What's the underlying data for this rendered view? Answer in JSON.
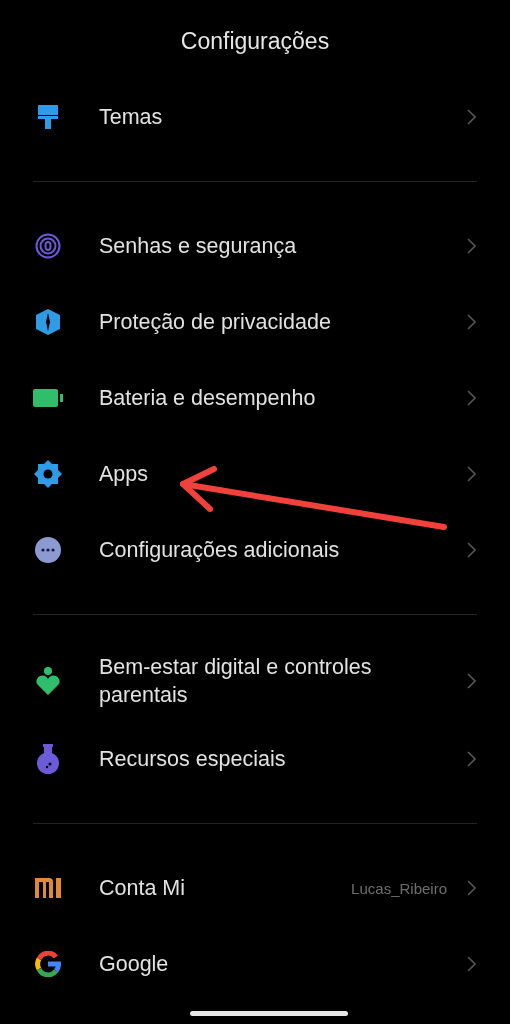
{
  "title": "Configurações",
  "groups": [
    {
      "items": [
        {
          "kind": "brush",
          "label": "Temas",
          "highlighted": false
        }
      ]
    },
    {
      "items": [
        {
          "kind": "fingerprint",
          "label": "Senhas e segurança",
          "highlighted": false
        },
        {
          "kind": "shield",
          "label": "Proteção de privacidade",
          "highlighted": false
        },
        {
          "kind": "battery",
          "label": "Bateria e desempenho",
          "highlighted": false
        },
        {
          "kind": "gear",
          "label": "Apps",
          "highlighted": true
        },
        {
          "kind": "dots",
          "label": "Configurações adicionais",
          "highlighted": false
        }
      ]
    },
    {
      "items": [
        {
          "kind": "wellbeing",
          "label": "Bem-estar digital e controles parentais",
          "highlighted": false
        },
        {
          "kind": "flask",
          "label": "Recursos especiais",
          "highlighted": false
        }
      ]
    },
    {
      "items": [
        {
          "kind": "mi",
          "label": "Conta Mi",
          "value": "Lucas_Ribeiro",
          "highlighted": false
        },
        {
          "kind": "google",
          "label": "Google",
          "highlighted": false
        }
      ]
    }
  ]
}
